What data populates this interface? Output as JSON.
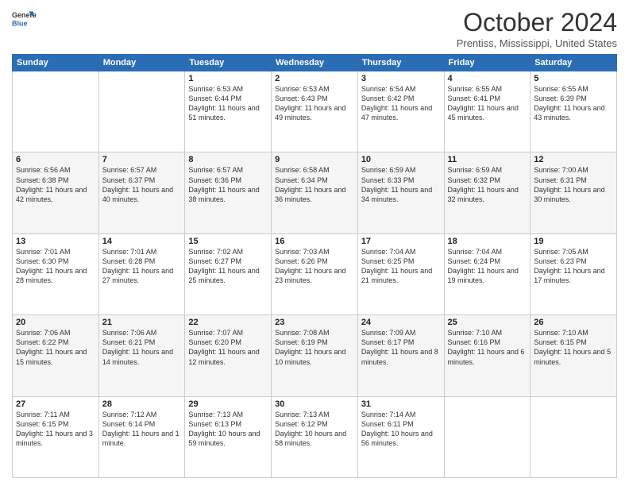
{
  "header": {
    "logo_general": "General",
    "logo_blue": "Blue",
    "title": "October 2024",
    "location": "Prentiss, Mississippi, United States"
  },
  "weekdays": [
    "Sunday",
    "Monday",
    "Tuesday",
    "Wednesday",
    "Thursday",
    "Friday",
    "Saturday"
  ],
  "weeks": [
    [
      {
        "day": "",
        "info": ""
      },
      {
        "day": "",
        "info": ""
      },
      {
        "day": "1",
        "info": "Sunrise: 6:53 AM\nSunset: 6:44 PM\nDaylight: 11 hours and 51 minutes."
      },
      {
        "day": "2",
        "info": "Sunrise: 6:53 AM\nSunset: 6:43 PM\nDaylight: 11 hours and 49 minutes."
      },
      {
        "day": "3",
        "info": "Sunrise: 6:54 AM\nSunset: 6:42 PM\nDaylight: 11 hours and 47 minutes."
      },
      {
        "day": "4",
        "info": "Sunrise: 6:55 AM\nSunset: 6:41 PM\nDaylight: 11 hours and 45 minutes."
      },
      {
        "day": "5",
        "info": "Sunrise: 6:55 AM\nSunset: 6:39 PM\nDaylight: 11 hours and 43 minutes."
      }
    ],
    [
      {
        "day": "6",
        "info": "Sunrise: 6:56 AM\nSunset: 6:38 PM\nDaylight: 11 hours and 42 minutes."
      },
      {
        "day": "7",
        "info": "Sunrise: 6:57 AM\nSunset: 6:37 PM\nDaylight: 11 hours and 40 minutes."
      },
      {
        "day": "8",
        "info": "Sunrise: 6:57 AM\nSunset: 6:36 PM\nDaylight: 11 hours and 38 minutes."
      },
      {
        "day": "9",
        "info": "Sunrise: 6:58 AM\nSunset: 6:34 PM\nDaylight: 11 hours and 36 minutes."
      },
      {
        "day": "10",
        "info": "Sunrise: 6:59 AM\nSunset: 6:33 PM\nDaylight: 11 hours and 34 minutes."
      },
      {
        "day": "11",
        "info": "Sunrise: 6:59 AM\nSunset: 6:32 PM\nDaylight: 11 hours and 32 minutes."
      },
      {
        "day": "12",
        "info": "Sunrise: 7:00 AM\nSunset: 6:31 PM\nDaylight: 11 hours and 30 minutes."
      }
    ],
    [
      {
        "day": "13",
        "info": "Sunrise: 7:01 AM\nSunset: 6:30 PM\nDaylight: 11 hours and 28 minutes."
      },
      {
        "day": "14",
        "info": "Sunrise: 7:01 AM\nSunset: 6:28 PM\nDaylight: 11 hours and 27 minutes."
      },
      {
        "day": "15",
        "info": "Sunrise: 7:02 AM\nSunset: 6:27 PM\nDaylight: 11 hours and 25 minutes."
      },
      {
        "day": "16",
        "info": "Sunrise: 7:03 AM\nSunset: 6:26 PM\nDaylight: 11 hours and 23 minutes."
      },
      {
        "day": "17",
        "info": "Sunrise: 7:04 AM\nSunset: 6:25 PM\nDaylight: 11 hours and 21 minutes."
      },
      {
        "day": "18",
        "info": "Sunrise: 7:04 AM\nSunset: 6:24 PM\nDaylight: 11 hours and 19 minutes."
      },
      {
        "day": "19",
        "info": "Sunrise: 7:05 AM\nSunset: 6:23 PM\nDaylight: 11 hours and 17 minutes."
      }
    ],
    [
      {
        "day": "20",
        "info": "Sunrise: 7:06 AM\nSunset: 6:22 PM\nDaylight: 11 hours and 15 minutes."
      },
      {
        "day": "21",
        "info": "Sunrise: 7:06 AM\nSunset: 6:21 PM\nDaylight: 11 hours and 14 minutes."
      },
      {
        "day": "22",
        "info": "Sunrise: 7:07 AM\nSunset: 6:20 PM\nDaylight: 11 hours and 12 minutes."
      },
      {
        "day": "23",
        "info": "Sunrise: 7:08 AM\nSunset: 6:19 PM\nDaylight: 11 hours and 10 minutes."
      },
      {
        "day": "24",
        "info": "Sunrise: 7:09 AM\nSunset: 6:17 PM\nDaylight: 11 hours and 8 minutes."
      },
      {
        "day": "25",
        "info": "Sunrise: 7:10 AM\nSunset: 6:16 PM\nDaylight: 11 hours and 6 minutes."
      },
      {
        "day": "26",
        "info": "Sunrise: 7:10 AM\nSunset: 6:15 PM\nDaylight: 11 hours and 5 minutes."
      }
    ],
    [
      {
        "day": "27",
        "info": "Sunrise: 7:11 AM\nSunset: 6:15 PM\nDaylight: 11 hours and 3 minutes."
      },
      {
        "day": "28",
        "info": "Sunrise: 7:12 AM\nSunset: 6:14 PM\nDaylight: 11 hours and 1 minute."
      },
      {
        "day": "29",
        "info": "Sunrise: 7:13 AM\nSunset: 6:13 PM\nDaylight: 10 hours and 59 minutes."
      },
      {
        "day": "30",
        "info": "Sunrise: 7:13 AM\nSunset: 6:12 PM\nDaylight: 10 hours and 58 minutes."
      },
      {
        "day": "31",
        "info": "Sunrise: 7:14 AM\nSunset: 6:11 PM\nDaylight: 10 hours and 56 minutes."
      },
      {
        "day": "",
        "info": ""
      },
      {
        "day": "",
        "info": ""
      }
    ]
  ]
}
